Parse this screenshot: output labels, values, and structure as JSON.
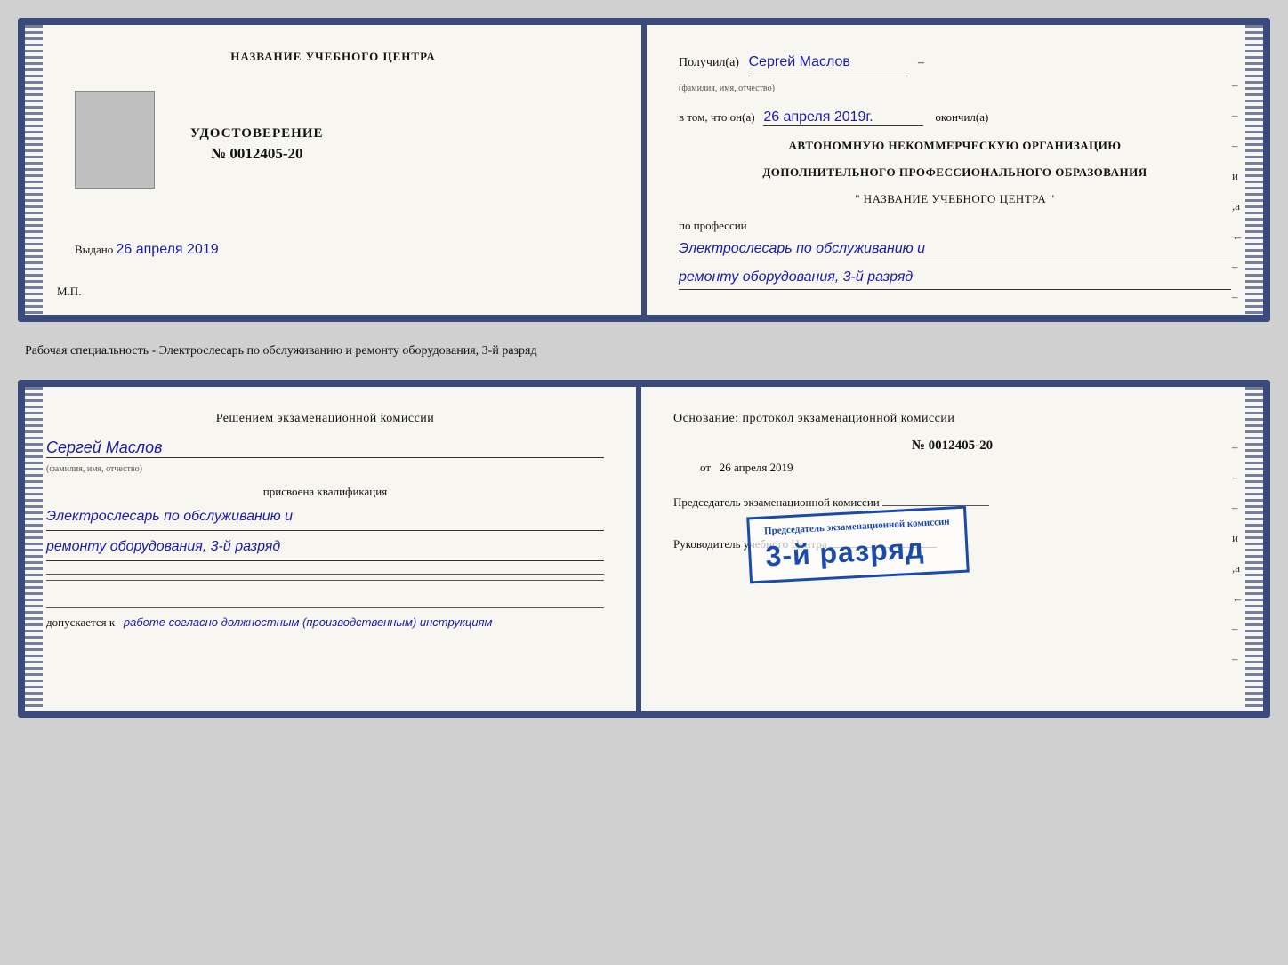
{
  "top_cert": {
    "left": {
      "header": "НАЗВАНИЕ УЧЕБНОГО ЦЕНТРА",
      "photo_alt": "Фото",
      "udostoverenie_label": "УДОСТОВЕРЕНИЕ",
      "number": "№ 0012405-20",
      "vydano_label": "Выдано",
      "vydano_date": "26 апреля 2019",
      "mp_label": "М.П."
    },
    "right": {
      "poluchil_label": "Получил(а)",
      "poluchil_name": "Сергей Маслов",
      "fio_subtitle": "(фамилия, имя, отчество)",
      "v_tom_label": "в том, что он(а)",
      "v_tom_date": "26 апреля 2019г.",
      "okonchil_label": "окончил(а)",
      "org_line1": "АВТОНОМНУЮ НЕКОММЕРЧЕСКУЮ ОРГАНИЗАЦИЮ",
      "org_line2": "ДОПОЛНИТЕЛЬНОГО ПРОФЕССИОНАЛЬНОГО ОБРАЗОВАНИЯ",
      "org_line3": "\"   НАЗВАНИЕ УЧЕБНОГО ЦЕНТРА   \"",
      "po_professii_label": "по профессии",
      "profession_line1": "Электрослесарь по обслуживанию и",
      "profession_line2": "ремонту оборудования, 3-й разряд"
    }
  },
  "middle_text": "Рабочая специальность - Электрослесарь по обслуживанию и ремонту оборудования, 3-й разряд",
  "bottom_cert": {
    "left": {
      "resheniye_title": "Решением экзаменационной комиссии",
      "name": "Сергей Маслов",
      "fio_subtitle": "(фамилия, имя, отчество)",
      "prisvoena_label": "присвоена квалификация",
      "qualification_line1": "Электрослесарь по обслуживанию и",
      "qualification_line2": "ремонту оборудования, 3-й разряд",
      "dopuskaetsya_label": "допускается к",
      "dopuskaetsya_value": "работе согласно должностным (производственным) инструкциям"
    },
    "right": {
      "osnovanie_label": "Основание: протокол экзаменационной комиссии",
      "protocol_num": "№  0012405-20",
      "ot_label": "от",
      "ot_date": "26 апреля 2019",
      "predsedatel_label": "Председатель экзаменационной комиссии",
      "rukovoditel_label": "Руководитель учебного Центра"
    },
    "stamp": {
      "line1": "3-й разряд"
    }
  },
  "dashes": [
    "-",
    "-",
    "-",
    "и",
    ",а",
    "←",
    "-",
    "-",
    "-"
  ]
}
